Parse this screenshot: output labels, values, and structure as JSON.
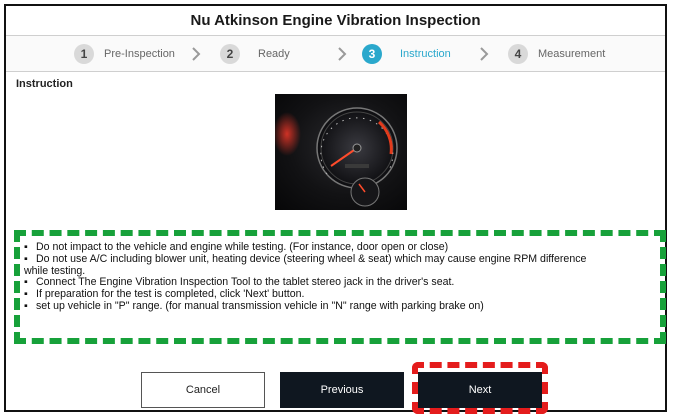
{
  "window": {
    "title": "Nu Atkinson Engine Vibration Inspection"
  },
  "stepper": {
    "steps": [
      {
        "number": "1",
        "label": "Pre-Inspection"
      },
      {
        "number": "2",
        "label": "Ready"
      },
      {
        "number": "3",
        "label": "Instruction",
        "active": true
      },
      {
        "number": "4",
        "label": "Measurement"
      }
    ]
  },
  "section": {
    "label": "Instruction"
  },
  "colors": {
    "accent": "#2aa8cc",
    "highlight_green": "#17a13a",
    "highlight_red": "#e41c1c",
    "button_dark": "#0f1720"
  },
  "instructions": {
    "items": [
      "Do not impact to the vehicle and engine while testing. (For instance, door open or close)",
      "Do not use A/C including blower unit, heating device (steering wheel & seat) which may cause engine RPM difference",
      "while testing.",
      "Connect The Engine Vibration Inspection Tool to the tablet stereo jack in the driver's seat.",
      "If preparation for the test is completed, click 'Next' button.",
      "set up vehicle in \"P\" range. (for manual transmission vehicle in \"N\" range with parking brake on)"
    ]
  },
  "buttons": {
    "cancel": "Cancel",
    "previous": "Previous",
    "next": "Next"
  }
}
